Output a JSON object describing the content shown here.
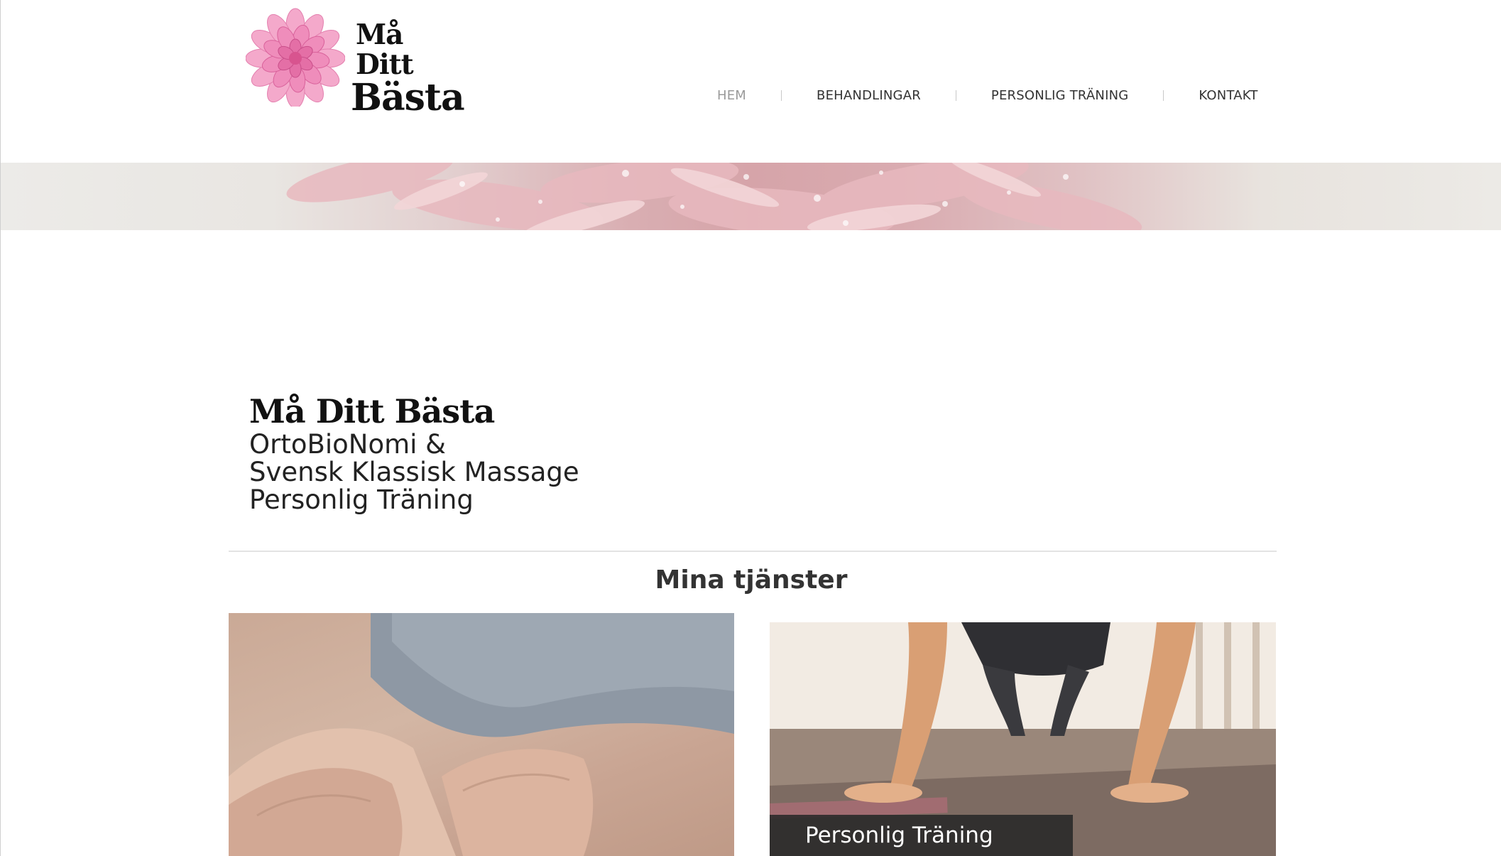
{
  "site": {
    "logo": {
      "line1": "Må Ditt",
      "line2": "Bästa",
      "flower_icon": "pink-dahlia-flower"
    }
  },
  "nav": {
    "items": [
      {
        "label": "HEM",
        "active": true
      },
      {
        "label": "BEHANDLINGAR",
        "active": false
      },
      {
        "label": "PERSONLIG TRÄNING",
        "active": false
      },
      {
        "label": "KONTAKT",
        "active": false
      }
    ]
  },
  "intro": {
    "title": "Må Ditt Bästa",
    "lines": [
      "OrtoBioNomi &",
      "Svensk Klassisk Massage",
      "Personlig Träning"
    ]
  },
  "services": {
    "heading": "Mina tjänster",
    "cards": [
      {
        "image": "massage-hands-photo",
        "label": ""
      },
      {
        "image": "push-up-training-photo",
        "label": "Personlig Träning"
      }
    ]
  },
  "colors": {
    "nav_active": "#9a9a9a",
    "nav_text": "#333333",
    "brand_pink": "#e06fa3",
    "label_bg": "#282828"
  }
}
